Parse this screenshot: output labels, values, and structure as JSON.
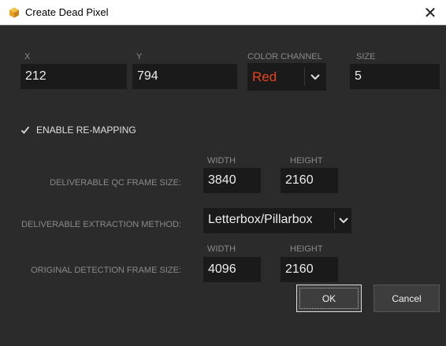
{
  "window": {
    "title": "Create Dead Pixel",
    "close_glyph": "✕"
  },
  "fields": {
    "x": {
      "label": "X",
      "value": "212"
    },
    "y": {
      "label": "Y",
      "value": "794"
    },
    "color_channel": {
      "label": "COLOR CHANNEL",
      "value": "Red",
      "value_color": "#e8421c"
    },
    "size": {
      "label": "SIZE",
      "value": "5"
    }
  },
  "remapping": {
    "checkbox_label": "ENABLE RE-MAPPING",
    "checked": true
  },
  "qc_frame": {
    "row_label": "DELIVERABLE QC FRAME SIZE:",
    "width_label": "WIDTH",
    "height_label": "HEIGHT",
    "width": "3840",
    "height": "2160"
  },
  "extraction": {
    "row_label": "DELIVERABLE EXTRACTION METHOD:",
    "value": "Letterbox/Pillarbox"
  },
  "detection_frame": {
    "row_label": "ORIGINAL DETECTION FRAME SIZE:",
    "width_label": "WIDTH",
    "height_label": "HEIGHT",
    "width": "4096",
    "height": "2160"
  },
  "buttons": {
    "ok": "OK",
    "cancel": "Cancel"
  },
  "icons": {
    "app": "hexagon-app-icon",
    "close": "close-icon",
    "dropdown": "chevron-down-icon",
    "check": "check-icon"
  },
  "colors": {
    "background": "#2b2b2b",
    "field_bg": "#1a1a1a",
    "accent_red": "#e8421c",
    "app_icon": "#e6a21f"
  }
}
